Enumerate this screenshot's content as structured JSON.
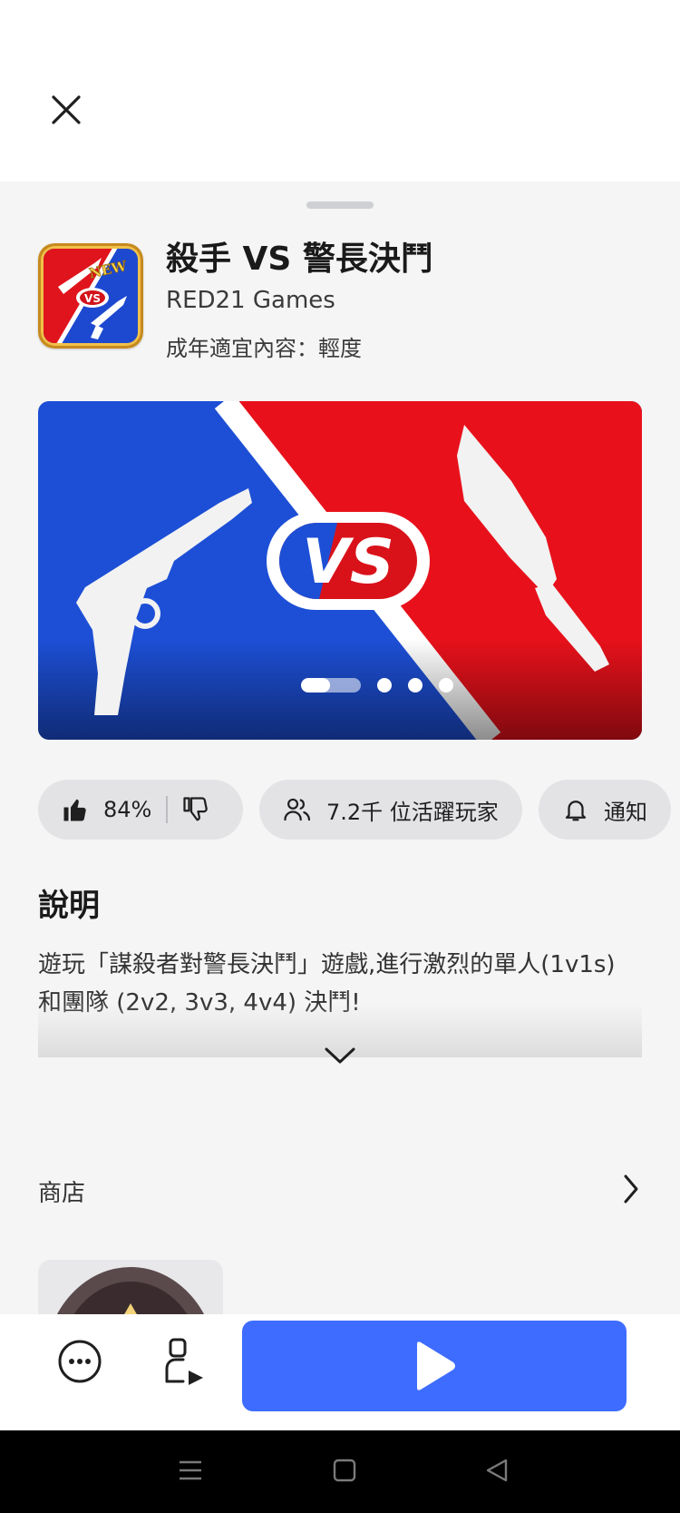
{
  "app": {
    "title": "殺手 VS 警長決鬥",
    "developer": "RED21 Games",
    "content_rating": "成年適宜內容：輕度",
    "icon_badge": "NEW",
    "icon_vs": "VS"
  },
  "banner": {
    "vs_text": "VS",
    "slide_count": 4,
    "active_slide": 1
  },
  "stats": {
    "like_percent": "84%",
    "players": "7.2千 位活躍玩家",
    "notify_label": "通知"
  },
  "description": {
    "title": "說明",
    "text": "遊玩「謀殺者對警長決鬥」遊戲,進行激烈的單人(1v1s) 和團隊 (2v2, 3v3, 4v4) 決鬥!"
  },
  "store": {
    "label": "商店"
  },
  "colors": {
    "play_button": "#3d6cff",
    "banner_red": "#e8111b",
    "banner_blue": "#1d4fd6"
  },
  "icons": {
    "close": "close-icon",
    "like": "thumbs-up-icon",
    "dislike": "thumbs-down-icon",
    "players": "people-icon",
    "notify": "bell-icon",
    "expand": "chevron-down-icon",
    "store": "chevron-right-icon",
    "more": "more-icon",
    "share": "share-icon",
    "play": "play-icon"
  }
}
